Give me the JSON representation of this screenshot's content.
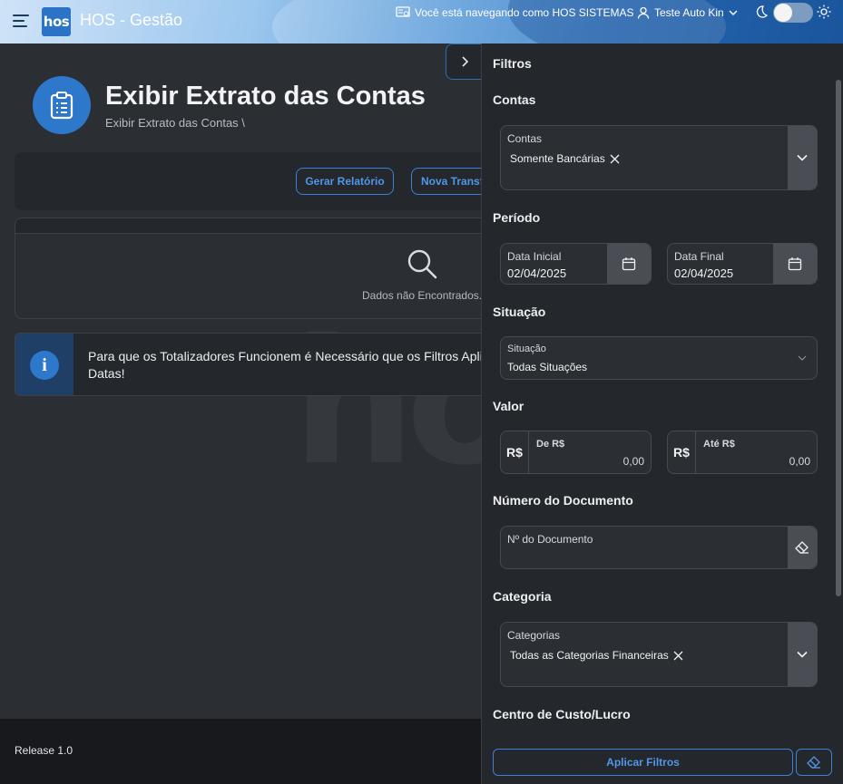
{
  "header": {
    "app_logo": "hos",
    "app_title": "HOS - Gestão",
    "browsing_as": "Você está navegando como HOS SISTEMAS",
    "user_name": "Teste Auto Kin"
  },
  "page": {
    "title": "Exibir Extrato das Contas",
    "breadcrumb": "Exibir Extrato das Contas  \\",
    "actions": {
      "report_label": "Gerar Relatório",
      "new_transfer_label": "Nova Transferência"
    },
    "empty_state": "Dados não Encontrados.",
    "info_message": "Para que os Totalizadores Funcionem é Necessário que os Filtros Aplicados sejam de Datas!",
    "watermark": "hos"
  },
  "footer": {
    "release": "Release 1.0"
  },
  "filters": {
    "panel_title": "Filtros",
    "accounts": {
      "section": "Contas",
      "label": "Contas",
      "chip": "Somente Bancárias"
    },
    "period": {
      "section": "Período",
      "start_label": "Data Inicial",
      "start_value": "02/04/2025",
      "end_label": "Data Final",
      "end_value": "02/04/2025"
    },
    "status": {
      "section": "Situação",
      "label": "Situação",
      "value": "Todas Situações"
    },
    "amount": {
      "section": "Valor",
      "currency": "R$",
      "from_label": "De R$",
      "from_value": "0,00",
      "to_label": "Até R$",
      "to_value": "0,00"
    },
    "document": {
      "section": "Número do Documento",
      "placeholder": "Nº do Documento"
    },
    "category": {
      "section": "Categoria",
      "label": "Categorias",
      "chip": "Todas as Categorias Financeiras"
    },
    "cost_center": {
      "section": "Centro de Custo/Lucro"
    },
    "apply_label": "Aplicar Filtros"
  },
  "colors": {
    "accent": "#2e78cc",
    "panel": "#24272b",
    "background": "#2b2e33"
  }
}
